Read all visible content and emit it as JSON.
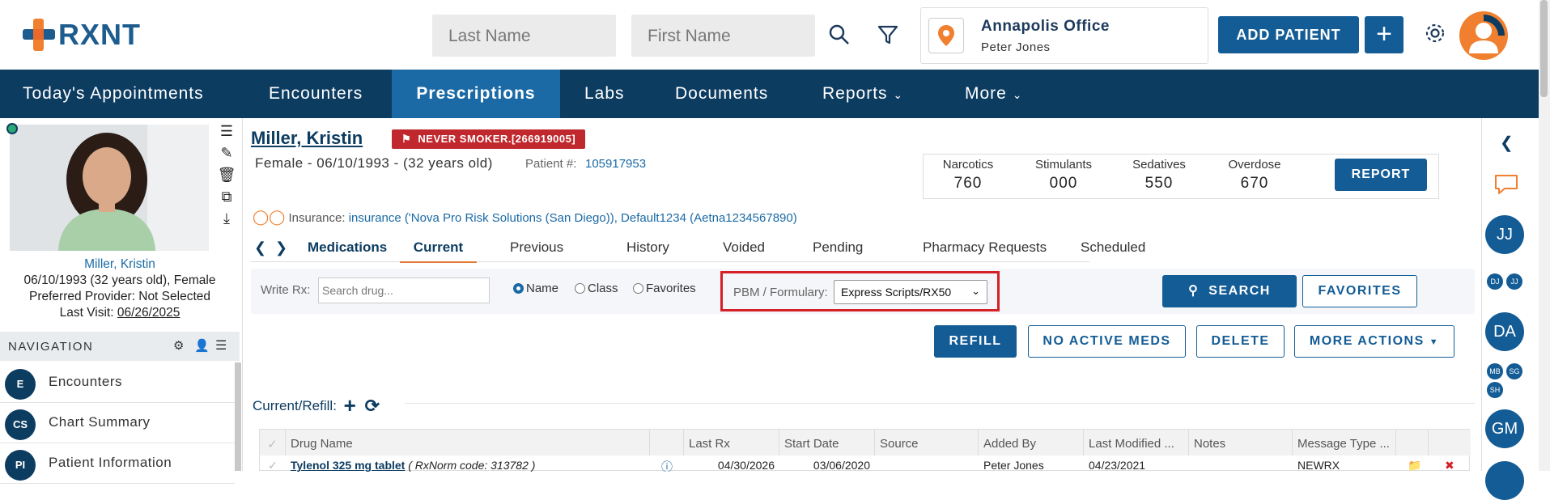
{
  "header": {
    "logo_text": "RXNT",
    "last_name_placeholder": "Last Name",
    "first_name_placeholder": "First Name",
    "office_name": "Annapolis Office",
    "office_user": "Peter Jones",
    "add_patient_label": "ADD PATIENT",
    "plus_label": "+"
  },
  "nav": {
    "items": [
      "Today's Appointments",
      "Encounters",
      "Prescriptions",
      "Labs",
      "Documents",
      "Reports",
      "More"
    ],
    "active": "Prescriptions"
  },
  "patient": {
    "name_link": "Miller, Kristin",
    "dob_line": "06/10/1993 (32 years old), Female",
    "provider_line": "Preferred Provider: Not Selected",
    "last_visit_label": "Last Visit:",
    "last_visit_date": "06/26/2025",
    "title": "Miller, Kristin",
    "flag": "NEVER SMOKER.[266919005]",
    "demographics": "Female - 06/10/1993 - (32 years old)",
    "patient_num_label": "Patient #:",
    "patient_num": "105917953",
    "insurance_label": "Insurance:",
    "insurance_value": "insurance ('Nova Pro Risk Solutions (San Diego)), Default1234 (Aetna1234567890)"
  },
  "navigation_panel": {
    "title": "NAVIGATION",
    "items": [
      {
        "badge": "E",
        "label": "Encounters"
      },
      {
        "badge": "CS",
        "label": "Chart Summary"
      },
      {
        "badge": "PI",
        "label": "Patient Information"
      }
    ]
  },
  "stats": {
    "items": [
      {
        "label": "Narcotics",
        "value": "760"
      },
      {
        "label": "Stimulants",
        "value": "000"
      },
      {
        "label": "Sedatives",
        "value": "550"
      },
      {
        "label": "Overdose",
        "value": "670"
      }
    ],
    "report_label": "REPORT"
  },
  "tabs": {
    "section": "Medications",
    "items": [
      "Current",
      "Previous",
      "History",
      "Voided",
      "Pending",
      "Pharmacy Requests",
      "Scheduled"
    ],
    "active": "Current"
  },
  "write_rx": {
    "label": "Write Rx:",
    "placeholder": "Search drug...",
    "radios": [
      {
        "label": "Name",
        "checked": true
      },
      {
        "label": "Class",
        "checked": false
      },
      {
        "label": "Favorites",
        "checked": false
      }
    ],
    "pbm_label": "PBM / Formulary:",
    "pbm_value": "Express Scripts/RX50",
    "search_label": "SEARCH",
    "favorites_label": "FAVORITES"
  },
  "actions": {
    "refill": "REFILL",
    "no_active_meds": "NO ACTIVE MEDS",
    "delete": "DELETE",
    "more_actions": "MORE ACTIONS"
  },
  "current_refill": {
    "label": "Current/Refill:"
  },
  "table": {
    "columns": [
      "Drug Name",
      "Last Rx",
      "Start Date",
      "Source",
      "Added By",
      "Last Modified ...",
      "Notes",
      "Message Type ..."
    ],
    "rows": [
      {
        "drug": "Tylenol 325 mg tablet",
        "drug_suffix": "( RxNorm code: 313782 )",
        "last_rx": "04/30/2026",
        "start_date": "03/06/2020",
        "source": "",
        "added_by": "Peter Jones",
        "last_modified": "04/23/2021",
        "notes": "",
        "message_type": "NEWRX"
      }
    ]
  },
  "right_rail": {
    "big": [
      "JJ",
      "DA",
      "GM"
    ],
    "small_1": [
      "DJ",
      "JJ"
    ],
    "small_2": [
      "MB",
      "SG",
      "SH"
    ]
  },
  "colors": {
    "brand_dark": "#0d3c61",
    "brand_primary": "#135c96",
    "accent_orange": "#f07f2f",
    "flag_red": "#c0282d"
  }
}
